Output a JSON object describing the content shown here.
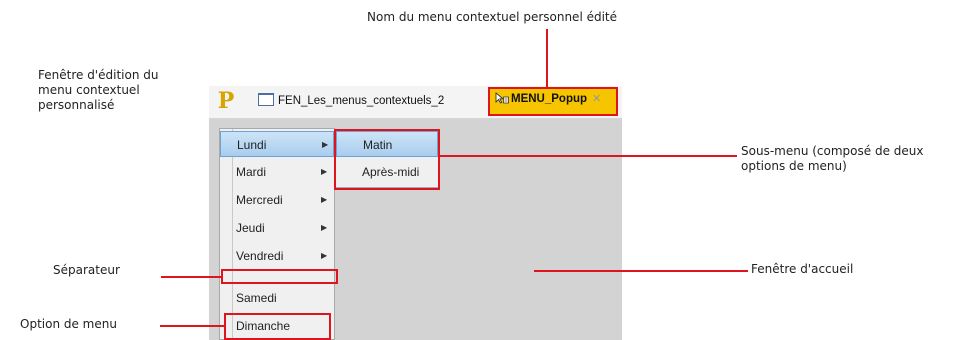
{
  "annotations": {
    "menu_name": "Nom du menu contextuel personnel édité",
    "editor_window": [
      "Fenêtre d'édition du",
      "menu contextuel",
      "personnalisé"
    ],
    "submenu": [
      "Sous-menu (composé de deux",
      "options de menu)"
    ],
    "separator": "Séparateur",
    "home_window": "Fenêtre d'accueil",
    "menu_option": "Option de menu"
  },
  "tabs": [
    {
      "label": "FEN_Les_menus_contextuels_2",
      "icon": "window-icon"
    },
    {
      "label": "MENU_Popup",
      "icon": "popup-menu-icon",
      "active": true
    }
  ],
  "menu": {
    "items": [
      {
        "label": "Lundi",
        "submenu": true,
        "selected": true
      },
      {
        "label": "Mardi",
        "submenu": true
      },
      {
        "label": "Mercredi",
        "submenu": true
      },
      {
        "label": "Jeudi",
        "submenu": true
      },
      {
        "label": "Vendredi",
        "submenu": true
      },
      {
        "separator": true
      },
      {
        "label": "Samedi"
      },
      {
        "label": "Dimanche"
      }
    ],
    "submenu_items": [
      {
        "label": "Matin",
        "selected": true
      },
      {
        "label": "Après-midi"
      }
    ]
  },
  "colors": {
    "annotation_red": "#e0141c",
    "active_tab": "#f7c400",
    "canvas": "#d3d3d3",
    "selection": "#a9cdee"
  }
}
